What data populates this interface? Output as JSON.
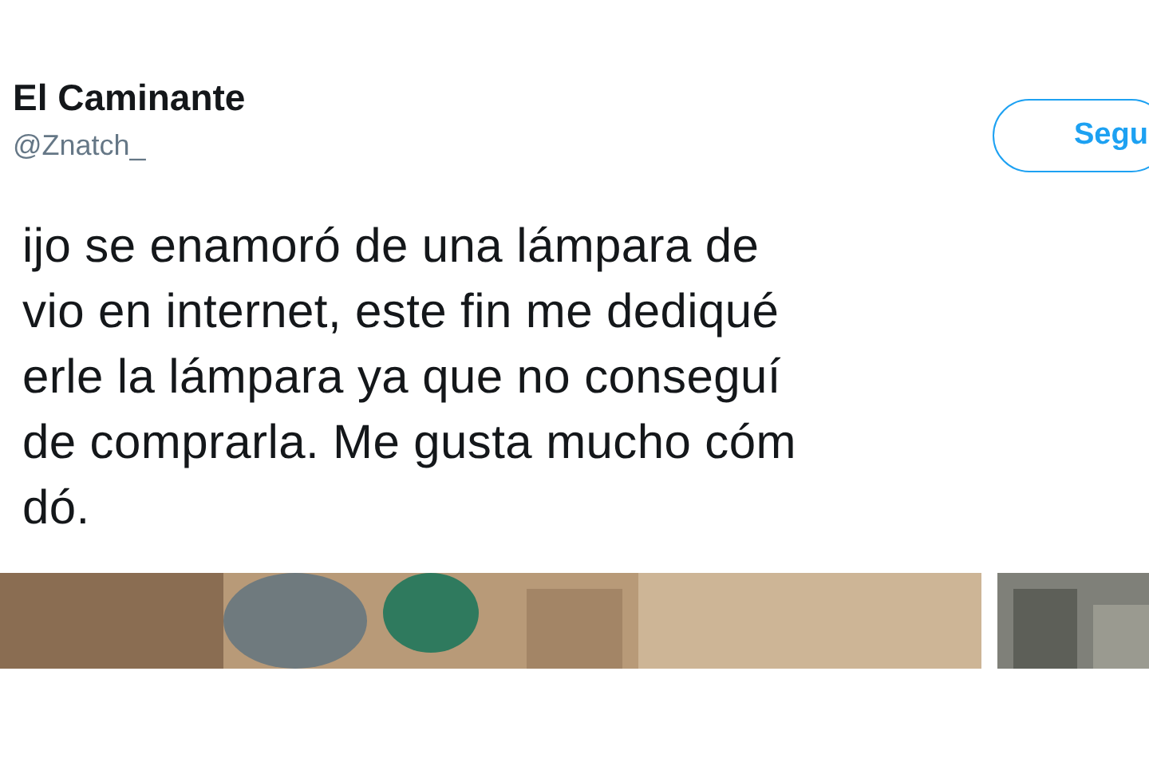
{
  "author": {
    "name": "El Caminante",
    "handle": "@Znatch_"
  },
  "follow_button": {
    "label": "Segu"
  },
  "tweet_lines": [
    "ijo se enamoró de una lámpara de",
    "vio en internet, este fin me dediqué",
    "erle la lámpara ya que no conseguí",
    "de comprarla. Me gusta mucho cóm",
    "dó."
  ]
}
